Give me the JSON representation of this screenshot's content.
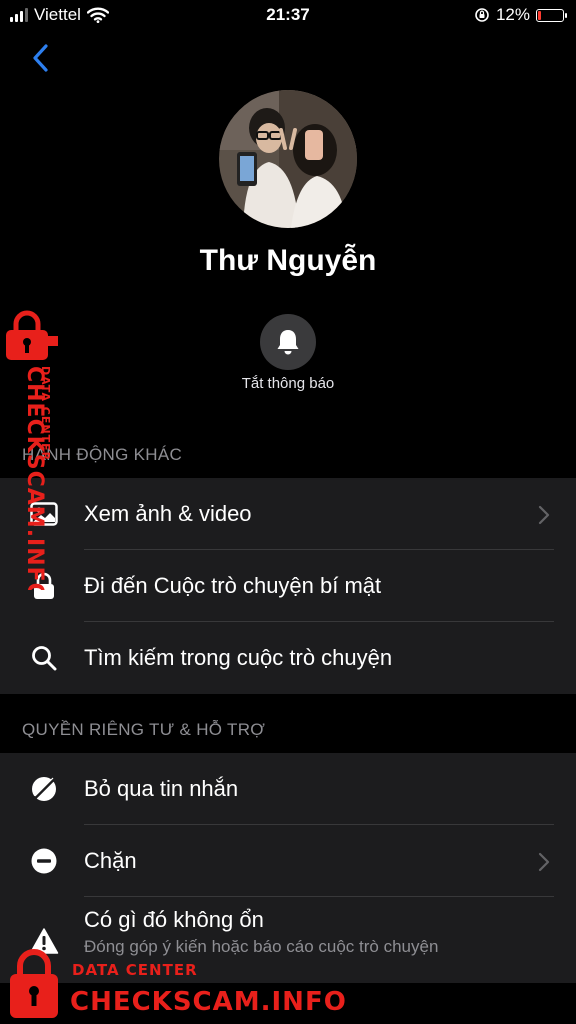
{
  "status_bar": {
    "carrier": "Viettel",
    "time": "21:37",
    "battery_percent": "12%",
    "battery_level": 0.12
  },
  "profile": {
    "name": "Thư Nguyễn"
  },
  "mute": {
    "label": "Tắt thông báo"
  },
  "sections": {
    "other_actions": {
      "header": "HÀNH ĐỘNG KHÁC",
      "items": [
        {
          "label": "Xem ảnh & video",
          "icon": "photo-icon",
          "chevron": true
        },
        {
          "label": "Đi đến Cuộc trò chuyện bí mật",
          "icon": "lock-icon",
          "chevron": false
        },
        {
          "label": "Tìm kiếm trong cuộc trò chuyện",
          "icon": "search-icon",
          "chevron": false
        }
      ]
    },
    "privacy": {
      "header": "QUYỀN RIÊNG TƯ & HỖ TRỢ",
      "items": [
        {
          "label": "Bỏ qua tin nhắn",
          "icon": "ignore-icon",
          "chevron": false
        },
        {
          "label": "Chặn",
          "icon": "block-icon",
          "chevron": true
        },
        {
          "label": "Có gì đó không ổn",
          "subtitle": "Đóng góp ý kiến hoặc báo cáo cuộc trò chuyện",
          "icon": "warning-icon",
          "chevron": false
        }
      ]
    }
  },
  "watermark": {
    "top_line": "DATA CENTER",
    "brand": "CHECKSCAM.INFO",
    "color": "#e8201b"
  }
}
